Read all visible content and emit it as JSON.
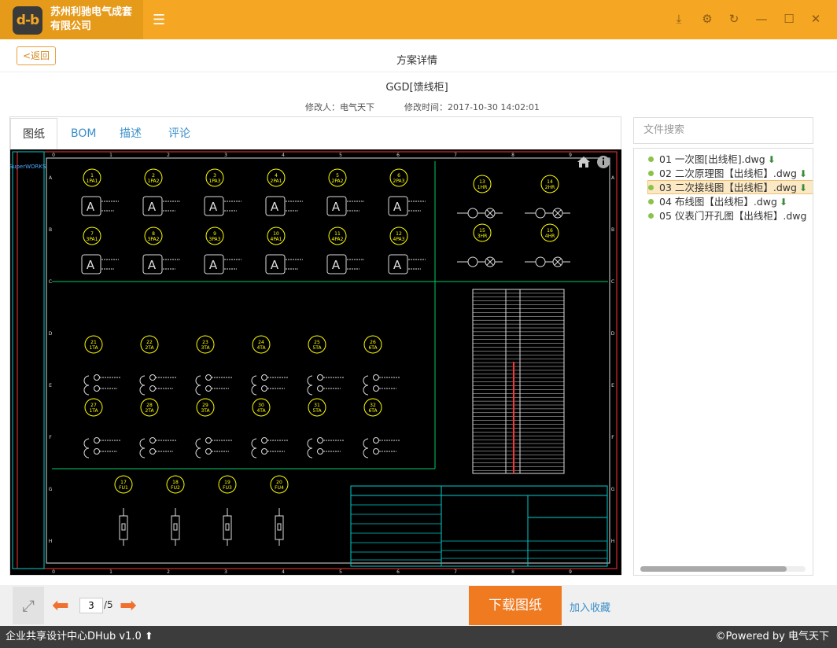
{
  "app": {
    "logo_text": "d-b",
    "company": "苏州利驰电气成套有限公司"
  },
  "header": {
    "back_label": "<返回",
    "page_title": "方案详情",
    "plan_name": "GGD[馈线柜]",
    "modifier_label": "修改人：电气天下",
    "modified_time_label": "修改时间：2017-10-30 14:02:01"
  },
  "tabs": [
    {
      "label": "图纸"
    },
    {
      "label": "BOM"
    },
    {
      "label": "描述"
    },
    {
      "label": "评论"
    }
  ],
  "drawing": {
    "brand_text": "SuperWORKS",
    "col_numbers": [
      "0",
      "1",
      "2",
      "3",
      "4",
      "5",
      "6",
      "7",
      "8",
      "9"
    ],
    "row_letters": [
      "A",
      "B",
      "C",
      "D",
      "E",
      "F",
      "G",
      "H"
    ],
    "ammeters_top": [
      "1PA1",
      "1PA2",
      "1PA3",
      "2PA1",
      "2PA2",
      "2PA3"
    ],
    "ammeters_mid": [
      "3PA1",
      "3PA2",
      "3PA3",
      "4PA1",
      "4PA2",
      "4PA3"
    ],
    "lamps": [
      "1HR",
      "2HR",
      "3HR",
      "4HR"
    ],
    "ct_top": [
      "1TA",
      "2TA",
      "3TA",
      "4TA",
      "5TA",
      "6TA"
    ],
    "ct_bottom": [
      "1TA",
      "2TA",
      "3TA",
      "4TA",
      "5TA",
      "6TA"
    ],
    "fuses": [
      "FU1",
      "FU2",
      "FU3",
      "FU4"
    ],
    "top_numbers": [
      "1",
      "2",
      "3",
      "4",
      "5",
      "6"
    ],
    "mid_numbers": [
      "7",
      "8",
      "9",
      "10",
      "11",
      "12"
    ],
    "lamp_numbers": [
      "13",
      "14",
      "15",
      "16"
    ],
    "ct_top_numbers": [
      "21",
      "22",
      "23",
      "24",
      "25",
      "26"
    ],
    "ct_bottom_numbers": [
      "27",
      "28",
      "29",
      "30",
      "31",
      "32"
    ],
    "fuse_numbers": [
      "17",
      "18",
      "19",
      "20"
    ]
  },
  "sidebar": {
    "search_placeholder": "文件搜索",
    "files": [
      {
        "name": "01 一次图[出线柜].dwg",
        "downloadable": true,
        "selected": false
      },
      {
        "name": "02 二次原理图【出线柜】.dwg",
        "downloadable": true,
        "selected": false
      },
      {
        "name": "03 二次接线图【出线柜】.dwg",
        "downloadable": true,
        "selected": true
      },
      {
        "name": "04 布线图【出线柜】.dwg",
        "downloadable": true,
        "selected": false
      },
      {
        "name": "05 仪表门开孔图【出线柜】.dwg",
        "downloadable": false,
        "selected": false
      }
    ]
  },
  "pager": {
    "current": "3",
    "total": "/5"
  },
  "actions": {
    "download_label": "下载图纸",
    "favorite_label": "加入收藏"
  },
  "statusbar": {
    "left": "企业共享设计中心DHub v1.0",
    "right": "©Powered by 电气天下"
  },
  "colors": {
    "accent": "#f5a623",
    "download": "#f07a20",
    "link": "#3a8fc8"
  }
}
